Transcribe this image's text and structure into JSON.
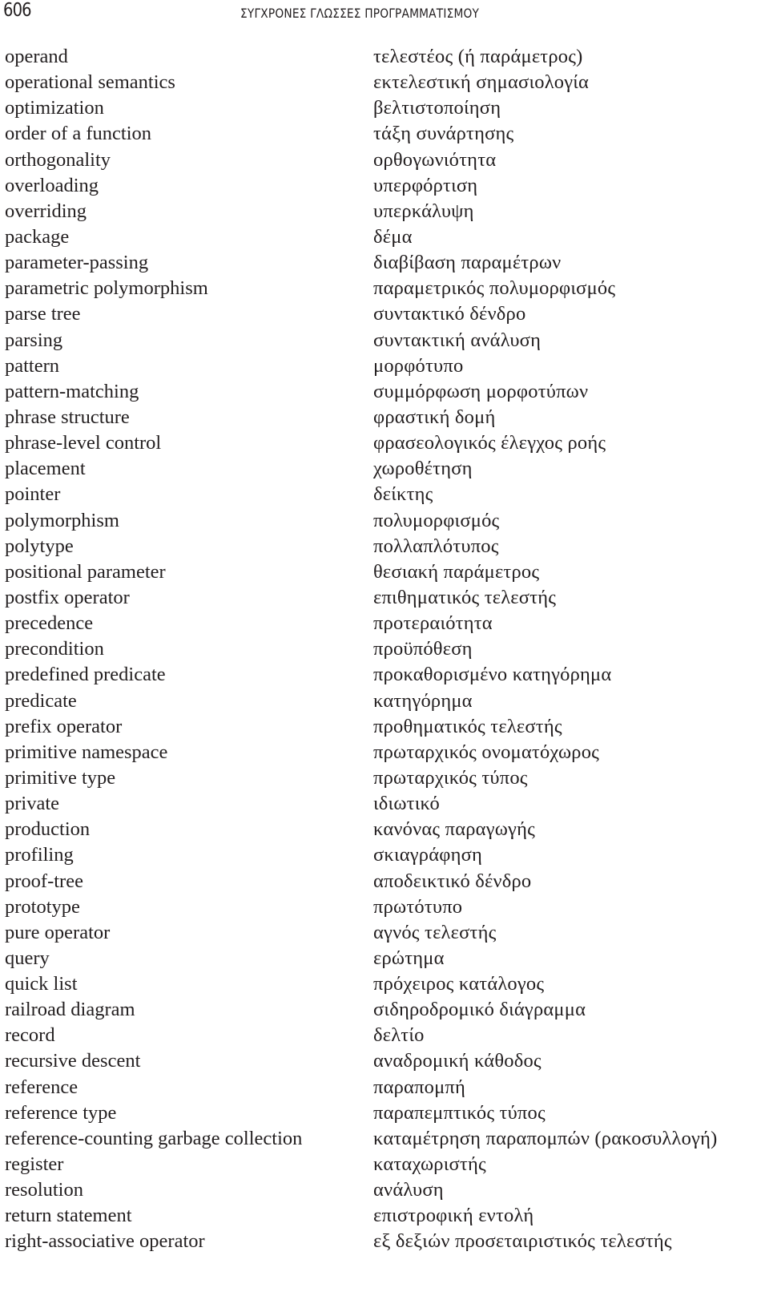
{
  "header": {
    "page_number": "606",
    "running_title": "ΣΥΓΧΡΟΝΕΣ ΓΛΩΣΣΕΣ ΠΡΟΓΡΑΜΜΑΤΙΣΜΟΥ"
  },
  "glossary": [
    {
      "en": "operand",
      "el": "τελεστέος (ή παράμετρος)"
    },
    {
      "en": "operational semantics",
      "el": "εκτελεστική σημασιολογία"
    },
    {
      "en": "optimization",
      "el": "βελτιστοποίηση"
    },
    {
      "en": "order of a function",
      "el": "τάξη συνάρτησης"
    },
    {
      "en": "orthogonality",
      "el": "ορθογωνιότητα"
    },
    {
      "en": "overloading",
      "el": "υπερφόρτιση"
    },
    {
      "en": "overriding",
      "el": "υπερκάλυψη"
    },
    {
      "en": "package",
      "el": "δέμα"
    },
    {
      "en": "parameter-passing",
      "el": "διαβίβαση παραμέτρων"
    },
    {
      "en": "parametric polymorphism",
      "el": "παραμετρικός πολυμορφισμός"
    },
    {
      "en": "parse tree",
      "el": "συντακτικό δένδρο"
    },
    {
      "en": "parsing",
      "el": "συντακτική ανάλυση"
    },
    {
      "en": "pattern",
      "el": "μορφότυπο"
    },
    {
      "en": "pattern-matching",
      "el": "συμμόρφωση μορφοτύπων"
    },
    {
      "en": "phrase structure",
      "el": "φραστική δομή"
    },
    {
      "en": "phrase-level control",
      "el": "φρασεολογικός έλεγχος ροής"
    },
    {
      "en": "placement",
      "el": "χωροθέτηση"
    },
    {
      "en": "pointer",
      "el": "δείκτης"
    },
    {
      "en": "polymorphism",
      "el": "πολυμορφισμός"
    },
    {
      "en": "polytype",
      "el": "πολλαπλότυπος"
    },
    {
      "en": "positional parameter",
      "el": "θεσιακή παράμετρος"
    },
    {
      "en": "postfix operator",
      "el": "επιθηματικός τελεστής"
    },
    {
      "en": "precedence",
      "el": "προτεραιότητα"
    },
    {
      "en": "precondition",
      "el": "προϋπόθεση"
    },
    {
      "en": "predefined predicate",
      "el": "προκαθορισμένο κατηγόρημα"
    },
    {
      "en": "predicate",
      "el": "κατηγόρημα"
    },
    {
      "en": "prefix operator",
      "el": "προθηματικός τελεστής"
    },
    {
      "en": "primitive namespace",
      "el": "πρωταρχικός ονοματόχωρος"
    },
    {
      "en": "primitive type",
      "el": "πρωταρχικός τύπος"
    },
    {
      "en": "private",
      "el": "ιδιωτικό"
    },
    {
      "en": "production",
      "el": "κανόνας παραγωγής"
    },
    {
      "en": "profiling",
      "el": "σκιαγράφηση"
    },
    {
      "en": "proof-tree",
      "el": "αποδεικτικό δένδρο"
    },
    {
      "en": "prototype",
      "el": "πρωτότυπο"
    },
    {
      "en": "pure operator",
      "el": "αγνός τελεστής"
    },
    {
      "en": "query",
      "el": "ερώτημα"
    },
    {
      "en": "quick list",
      "el": "πρόχειρος κατάλογος"
    },
    {
      "en": "railroad diagram",
      "el": "σιδηροδρομικό διάγραμμα"
    },
    {
      "en": "record",
      "el": "δελτίο"
    },
    {
      "en": "recursive descent",
      "el": "αναδρομική κάθοδος"
    },
    {
      "en": "reference",
      "el": "παραπομπή"
    },
    {
      "en": "reference type",
      "el": "παραπεμπτικός τύπος"
    },
    {
      "en": "reference-counting garbage collection",
      "el": "καταμέτρηση παραπομπών (ρακοσυλλογή)"
    },
    {
      "en": "register",
      "el": "καταχωριστής"
    },
    {
      "en": "resolution",
      "el": "ανάλυση"
    },
    {
      "en": "return statement",
      "el": "επιστροφική εντολή"
    },
    {
      "en": "right-associative operator",
      "el": "εξ δεξιών προσεταιριστικός τελεστής"
    }
  ]
}
